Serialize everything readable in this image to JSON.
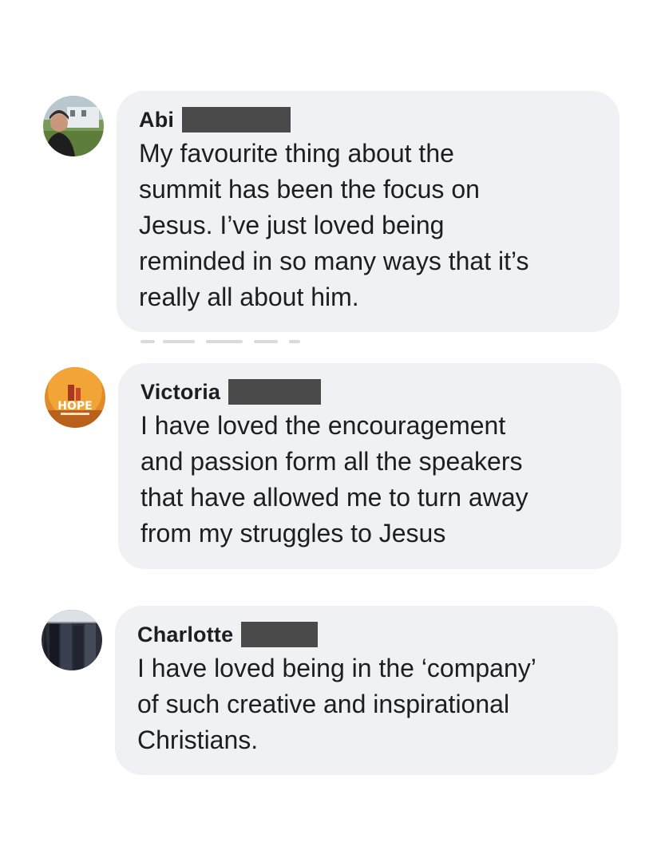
{
  "comments": [
    {
      "author": "Abi",
      "avatar_icon": "user-photo-avatar",
      "text": "My favourite thing about the\nsummit has been the focus on\nJesus. I’ve just loved being\nreminded in so many ways that it’s\nreally all about him."
    },
    {
      "author": "Victoria",
      "avatar_icon": "hope-logo-avatar",
      "avatar_label": "HOPE",
      "text": "I have loved the encouragement\nand passion form all the speakers\nthat have allowed me to turn away\nfrom my struggles to Jesus"
    },
    {
      "author": "Charlotte",
      "avatar_icon": "user-photo-avatar",
      "text": "I have loved being in the ‘company’\nof such creative and inspirational\nChristians."
    }
  ],
  "colors": {
    "bubble_bg": "#f0f1f5",
    "text": "#1c1e21",
    "redaction": "#4a4a4a"
  }
}
